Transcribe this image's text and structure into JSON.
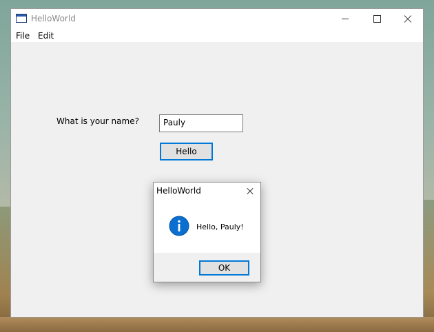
{
  "window": {
    "title": "HelloWorld",
    "icon": "app-window-icon"
  },
  "menu": {
    "items": [
      {
        "label": "File"
      },
      {
        "label": "Edit"
      }
    ]
  },
  "form": {
    "name_label": "What is your name?",
    "name_value": "Pauly",
    "hello_button": "Hello"
  },
  "dialog": {
    "title": "HelloWorld",
    "icon": "info-icon",
    "message": "Hello, Pauly!",
    "ok_button": "OK"
  },
  "colors": {
    "accent": "#0078d7",
    "window_bg": "#f0f0f0"
  }
}
